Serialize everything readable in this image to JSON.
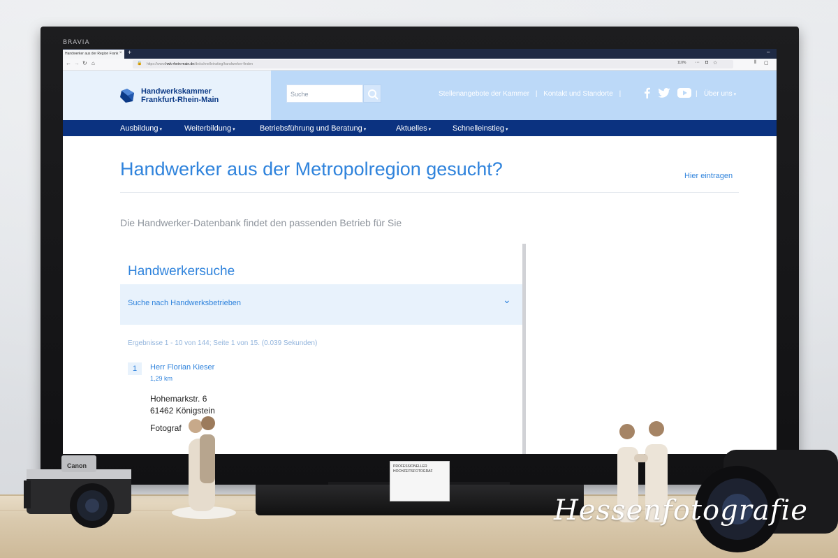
{
  "tv": {
    "brand": "BRAVIA"
  },
  "browser": {
    "tab_title": "Handwerker aus der Region Frank",
    "tab_close": "×",
    "new_tab": "+",
    "minimize": "–",
    "url_prefix": "https://www.",
    "url_host": "hwk-rhein-main.de",
    "url_path": "/de/schnelleinstieg/handwerker-finden",
    "zoom": "110%",
    "menu_dots": "···"
  },
  "site": {
    "logo_line1": "Handwerkskammer",
    "logo_line2": "Frankfurt-Rhein-Main",
    "search_placeholder": "Suche",
    "top_links": [
      "Stellenangebote der Kammer",
      "Kontakt und Standorte"
    ],
    "separator": "|",
    "about": "Über uns",
    "caret": "▾",
    "nav": [
      "Ausbildung",
      "Weiterbildung",
      "Betriebsführung und Beratung",
      "Aktuelles",
      "Schnelleinstieg"
    ],
    "colors": {
      "header_dark": "#0b3280",
      "accent": "#2f83dc",
      "header_light": "#bcd9f8"
    }
  },
  "main": {
    "title": "Handwerker aus der Metropolregion gesucht?",
    "register_link": "Hier eintragen",
    "intro": "Die Handwerker-Datenbank findet den passenden Betrieb für Sie",
    "panel_title": "Handwerkersuche",
    "accordion_label": "Suche nach Handwerksbetrieben",
    "accordion_chevron": "⌄",
    "results_info": "Ergebnisse 1 - 10 von 144; Seite 1 von 15. (0.039 Sekunden)",
    "results": [
      {
        "rank": "1",
        "name": "Herr Florian Kieser",
        "distance": "1,29 km",
        "street": "Hohemarkstr. 6",
        "city": "61462 Königstein",
        "trade": "Fotograf"
      }
    ]
  },
  "shelf": {
    "business_card_lines": [
      "PROFESSIONELLER",
      "HOCHZEITSFOTOGRAF"
    ],
    "camera_brand": "Canon"
  },
  "watermark": "Hessenfotografie"
}
